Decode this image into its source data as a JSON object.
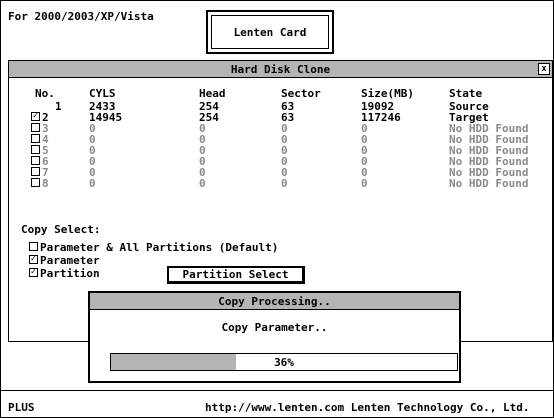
{
  "header": {
    "os_text": "For 2000/2003/XP/Vista",
    "card_button": "Lenten Card"
  },
  "main_window": {
    "title": "Hard Disk Clone",
    "close_glyph": "x",
    "columns": {
      "no": "No.",
      "cyls": "CYLS",
      "head": "Head",
      "sector": "Sector",
      "size": "Size(MB)",
      "state": "State"
    },
    "rows": [
      {
        "no": "1",
        "checkbox": false,
        "checked": false,
        "enabled": true,
        "cyls": "2433",
        "head": "254",
        "sector": "63",
        "size": "19092",
        "state": "Source"
      },
      {
        "no": "2",
        "checkbox": true,
        "checked": true,
        "enabled": true,
        "cyls": "14945",
        "head": "254",
        "sector": "63",
        "size": "117246",
        "state": "Target"
      },
      {
        "no": "3",
        "checkbox": true,
        "checked": false,
        "enabled": false,
        "cyls": "0",
        "head": "0",
        "sector": "0",
        "size": "0",
        "state": "No HDD Found"
      },
      {
        "no": "4",
        "checkbox": true,
        "checked": false,
        "enabled": false,
        "cyls": "0",
        "head": "0",
        "sector": "0",
        "size": "0",
        "state": "No HDD Found"
      },
      {
        "no": "5",
        "checkbox": true,
        "checked": false,
        "enabled": false,
        "cyls": "0",
        "head": "0",
        "sector": "0",
        "size": "0",
        "state": "No HDD Found"
      },
      {
        "no": "6",
        "checkbox": true,
        "checked": false,
        "enabled": false,
        "cyls": "0",
        "head": "0",
        "sector": "0",
        "size": "0",
        "state": "No HDD Found"
      },
      {
        "no": "7",
        "checkbox": true,
        "checked": false,
        "enabled": false,
        "cyls": "0",
        "head": "0",
        "sector": "0",
        "size": "0",
        "state": "No HDD Found"
      },
      {
        "no": "8",
        "checkbox": true,
        "checked": false,
        "enabled": false,
        "cyls": "0",
        "head": "0",
        "sector": "0",
        "size": "0",
        "state": "No HDD Found"
      }
    ],
    "copy_select_label": "Copy Select:",
    "options": [
      {
        "label": "Parameter & All Partitions (Default)",
        "checked": false
      },
      {
        "label": "Parameter",
        "checked": true
      },
      {
        "label": "Partition",
        "checked": true
      }
    ],
    "partition_select_button": "Partition Select"
  },
  "dialog": {
    "title": "Copy Processing..",
    "message": "Copy Parameter..",
    "progress_percent": 36,
    "progress_text": "36%"
  },
  "status_bar": {
    "left": "PLUS",
    "right": "http://www.lenten.com  Lenten Technology Co., Ltd."
  },
  "colors": {
    "title_bar": "#b4b4b4",
    "disabled_text": "#8a8a8a"
  }
}
